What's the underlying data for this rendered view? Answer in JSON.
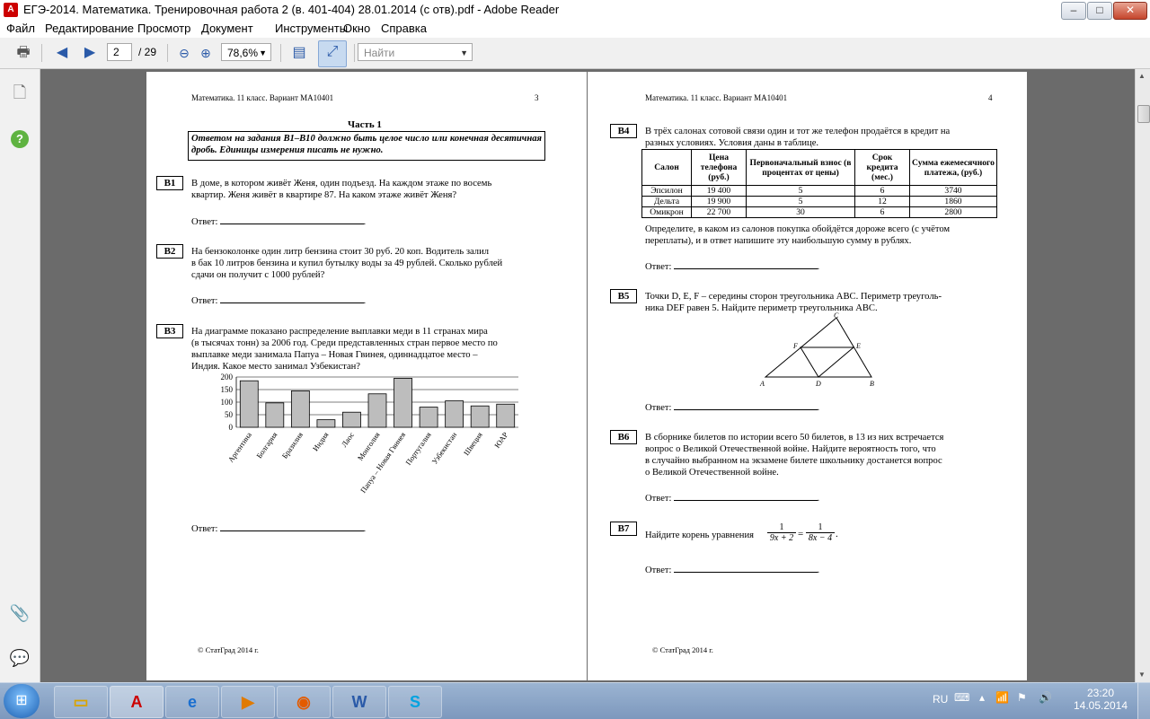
{
  "window": {
    "title": "ЕГЭ-2014. Математика. Тренировочная работа 2 (в. 401-404) 28.01.2014 (с отв).pdf - Adobe Reader",
    "app_icon": "adobe-reader-icon",
    "controls": [
      "minimize",
      "maximize",
      "close"
    ]
  },
  "menu": [
    "Файл",
    "Редактирование",
    "Просмотр",
    "Документ",
    "Инструменты",
    "Окно",
    "Справка"
  ],
  "toolbar": {
    "page_current": "2",
    "page_total": "/ 29",
    "zoom": "78,6%",
    "find_placeholder": "Найти"
  },
  "page3": {
    "header_left": "Математика. 11 класс. Вариант МА10401",
    "header_right": "3",
    "part_title": "Часть 1",
    "instruction": "Ответом на задания В1–В10 должно быть целое число или конечная десятичная дробь. Единицы измерения писать не нужно.",
    "questions": [
      {
        "id": "B1",
        "lines": [
          "В доме, в котором живёт Женя, один подъезд. На каждом этаже по восемь",
          "квартир. Женя живёт в квартире 87. На каком этаже живёт Женя?"
        ]
      },
      {
        "id": "B2",
        "lines": [
          "На бензоколонке один литр бензина стоит 30 руб. 20 коп. Водитель залил",
          "в бак 10 литров бензина и купил бутылку воды за 49 рублей. Сколько рублей",
          "сдачи он получит с 1000 рублей?"
        ]
      },
      {
        "id": "B3",
        "lines": [
          "На диаграмме показано распределение выплавки меди в 11 странах мира",
          "(в тысячах тонн) за 2006 год. Среди представленных стран первое место по",
          "выплавке меди занимала Папуа – Новая Гвинея, одиннадцатое место –",
          "Индия. Какое место занимал Узбекистан?"
        ]
      }
    ],
    "answer_label": "Ответ:",
    "footer": "© СтатГрад 2014 г."
  },
  "page4": {
    "header_left": "Математика. 11 класс. Вариант МА10401",
    "header_right": "4",
    "questions": [
      {
        "id": "B4",
        "lines": [
          "В трёх салонах сотовой связи один и тот же телефон продаётся в кредит на",
          "разных условиях. Условия даны в таблице."
        ],
        "after": [
          "Определите, в каком из салонов покупка обойдётся дороже всего (с учётом",
          "переплаты), и в ответ напишите эту наибольшую сумму в рублях."
        ]
      },
      {
        "id": "B5",
        "lines": [
          "Точки D, E, F – середины сторон треугольника ABC. Периметр треуголь-",
          "ника DEF равен 5. Найдите периметр треугольника ABC."
        ]
      },
      {
        "id": "B6",
        "lines": [
          "В сборнике билетов по истории всего 50 билетов, в 13 из них встречается",
          "вопрос о Великой Отечественной войне. Найдите вероятность того, что",
          "в случайно выбранном на экзамене билете школьнику достанется вопрос",
          "о Великой Отечественной войне."
        ]
      },
      {
        "id": "B7",
        "lines": [
          "Найдите корень уравнения"
        ],
        "eq_left_num": "1",
        "eq_left_den": "9x + 2",
        "eq_right_num": "1",
        "eq_right_den": "8x − 4"
      }
    ],
    "table": {
      "headers": [
        "Салон",
        "Цена телефона (руб.)",
        "Первоначальный взнос (в процентах от цены)",
        "Срок кредита (мес.)",
        "Сумма ежемесячного платежа, (руб.)"
      ],
      "rows": [
        [
          "Эпсилон",
          "19 400",
          "5",
          "6",
          "3740"
        ],
        [
          "Дельта",
          "19 900",
          "5",
          "12",
          "1860"
        ],
        [
          "Омикрон",
          "22 700",
          "30",
          "6",
          "2800"
        ]
      ]
    },
    "triangle_labels": [
      "A",
      "B",
      "C",
      "D",
      "E",
      "F"
    ],
    "answer_label": "Ответ:",
    "footer": "© СтатГрад 2014 г."
  },
  "chart_data": {
    "type": "bar",
    "categories": [
      "Аргентина",
      "Болгария",
      "Бразилия",
      "Индия",
      "Лаос",
      "Монголия",
      "Папуа – Новая Гвинея",
      "Португалия",
      "Узбекистан",
      "Швеция",
      "ЮАР"
    ],
    "values": [
      185,
      97,
      145,
      30,
      60,
      133,
      195,
      80,
      105,
      85,
      92
    ],
    "ylim": [
      0,
      200
    ],
    "yticks": [
      "200",
      "150",
      "100",
      "50",
      "0"
    ],
    "grid": true,
    "bar_color": "#bdbdbd"
  },
  "sidepanel": [
    "page-thumbnails-icon",
    "help-icon",
    "attachment-icon",
    "comments-icon"
  ],
  "taskbar": {
    "apps": [
      "explorer-icon",
      "acrobat-icon",
      "ie-icon",
      "media-player-icon",
      "firefox-icon",
      "word-icon",
      "skype-icon"
    ],
    "lang": "RU",
    "time": "23:20",
    "date": "14.05.2014"
  }
}
